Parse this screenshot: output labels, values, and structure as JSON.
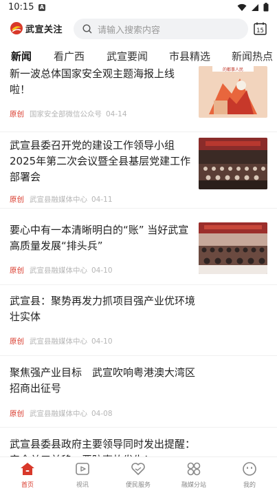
{
  "status": {
    "time": "10:15",
    "badge": "A"
  },
  "header": {
    "logo_text": "武宣关注",
    "search_placeholder": "请输入搜索内容",
    "calendar_day": "15"
  },
  "tabs": [
    "新闻",
    "看广西",
    "武宣要闻",
    "市县精选",
    "新闻热点"
  ],
  "feed": [
    {
      "title": "新一波总体国家安全观主题海报上线啦！",
      "tag": "原创",
      "source": "国家安全部微信公众号",
      "date": "04-14",
      "thumb_caption": "的都事人民"
    },
    {
      "title": "武宣县委召开党的建设工作领导小组2025年第二次会议暨全县基层党建工作部署会",
      "tag": "原创",
      "source": "武宣县融媒体中心",
      "date": "04-11"
    },
    {
      "title": "要心中有一本清晰明白的“账” 当好武宣高质量发展“排头兵”",
      "tag": "原创",
      "source": "武宣县融媒体中心",
      "date": "04-10"
    },
    {
      "title": "武宣县：聚势再发力抓项目强产业优环境壮实体",
      "tag": "原创",
      "source": "武宣县融媒体中心",
      "date": "04-10"
    },
    {
      "title": "聚焦强产业目标　武宣吹响粤港澳大湾区招商出征号",
      "tag": "原创",
      "source": "武宣县融媒体中心",
      "date": "04-08"
    },
    {
      "title": "武宣县委县政府主要领导同时发出提醒：安全关口前移，严防事故发生！",
      "tag": "",
      "source": "",
      "date": ""
    }
  ],
  "bottom_nav": [
    {
      "label": "首页",
      "icon": "home-icon",
      "active": true
    },
    {
      "label": "视讯",
      "icon": "video-icon",
      "active": false
    },
    {
      "label": "便民服务",
      "icon": "heart-hands-icon",
      "active": false
    },
    {
      "label": "融媒分站",
      "icon": "grid-icon",
      "active": false
    },
    {
      "label": "我的",
      "icon": "smile-icon",
      "active": false
    }
  ],
  "colors": {
    "accent": "#d8382a",
    "meta": "#b5b5b5",
    "search_bg": "#f1f2f4"
  }
}
